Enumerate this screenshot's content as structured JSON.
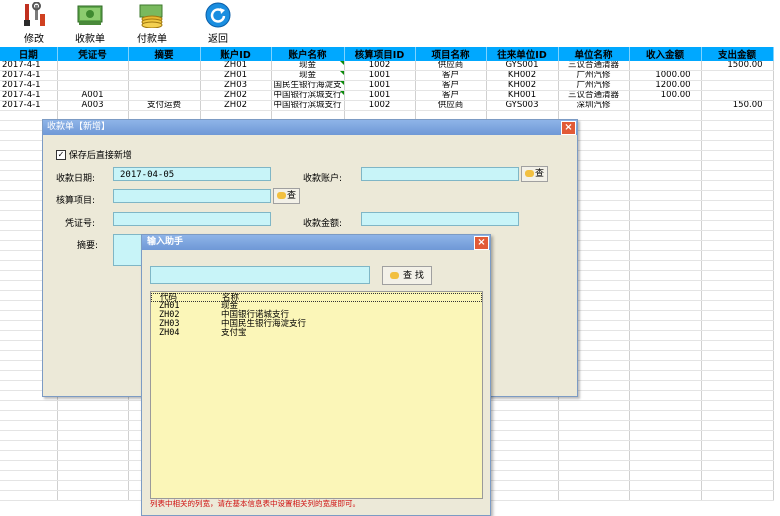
{
  "toolbar": {
    "edit": "修改",
    "receipt": "收款单",
    "payment": "付款单",
    "back": "返回"
  },
  "grid": {
    "headers": [
      "日期",
      "凭证号",
      "摘要",
      "账户ID",
      "账户名称",
      "核算项目ID",
      "项目名称",
      "往来单位ID",
      "单位名称",
      "收入金额",
      "支出金额"
    ],
    "rows": [
      [
        "2017-4-1",
        "",
        "",
        "ZH01",
        "现金",
        "1002",
        "供应商",
        "GYS001",
        "三议合通清器",
        "",
        "1500.00"
      ],
      [
        "2017-4-1",
        "",
        "",
        "ZH01",
        "现金",
        "1001",
        "客户",
        "KH002",
        "广州汽修",
        "1000.00",
        ""
      ],
      [
        "2017-4-1",
        "",
        "",
        "ZH03",
        "国民生银行海淀支",
        "1001",
        "客户",
        "KH002",
        "广州汽修",
        "1200.00",
        ""
      ],
      [
        "2017-4-1",
        "A001",
        "",
        "ZH02",
        "中国银行滨城支行",
        "1001",
        "客户",
        "KH001",
        "三议合通清器",
        "100.00",
        ""
      ],
      [
        "2017-4-1",
        "A003",
        "支付运费",
        "ZH02",
        "中国银行滨城支行",
        "1002",
        "供应商",
        "GYS003",
        "深圳汽修",
        "",
        "150.00"
      ]
    ]
  },
  "dialog": {
    "title": "收款单【新增】",
    "checkbox_label": "保存后直接新增",
    "date_label": "收款日期:",
    "date_value": "2017-04-05",
    "account_label": "收款账户:",
    "project_label": "核算项目:",
    "voucher_label": "凭证号:",
    "amount_label": "收款金额:",
    "summary_label": "摘要:",
    "lookup_label": "查"
  },
  "helper": {
    "title": "输入助手",
    "search_label": "查 找",
    "col_code": "代码",
    "col_name": "名称",
    "items": [
      {
        "code": "ZH01",
        "name": "现金"
      },
      {
        "code": "ZH02",
        "name": "中国银行诺城支行"
      },
      {
        "code": "ZH03",
        "name": "中国民生银行海淀支行"
      },
      {
        "code": "ZH04",
        "name": "支付宝"
      }
    ],
    "hint": "列表中相关的列宽，请在基本信息表中设置相关列的宽度即可。"
  },
  "colors": {
    "header": "#00a8ff",
    "field": "#c8f4f8",
    "list": "#fbf6b8",
    "hint": "#d01010"
  }
}
